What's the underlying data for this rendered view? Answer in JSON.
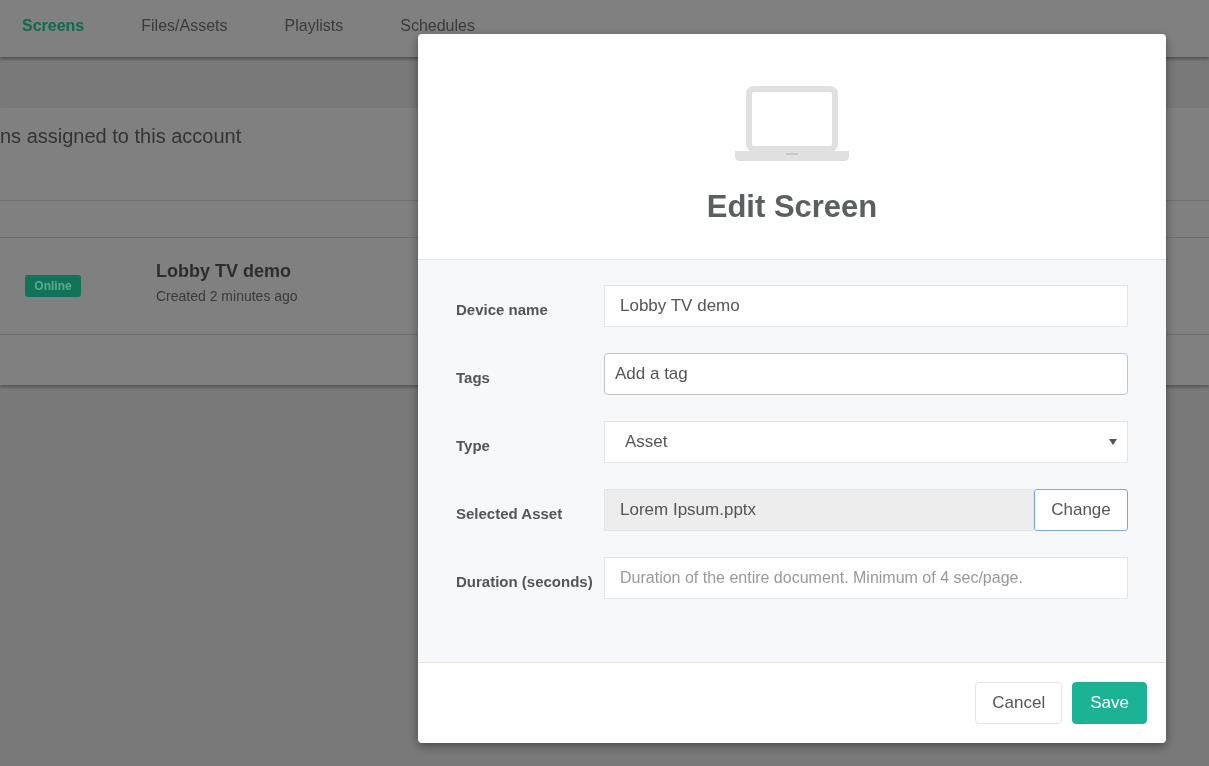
{
  "nav": {
    "tabs": [
      {
        "label": "Screens",
        "selected": true
      },
      {
        "label": "Files/Assets",
        "selected": false
      },
      {
        "label": "Playlists",
        "selected": false
      },
      {
        "label": "Schedules",
        "selected": false
      }
    ]
  },
  "page": {
    "heading": "ns assigned to this account",
    "screens": [
      {
        "status": "Online",
        "name": "Lobby TV demo",
        "created": "Created 2 minutes ago"
      }
    ]
  },
  "modal": {
    "title": "Edit Screen",
    "fields": [
      {
        "kind": "text",
        "label": "Device name",
        "value": "Lobby TV demo"
      },
      {
        "kind": "tags",
        "label": "Tags",
        "placeholder": "Add a tag"
      },
      {
        "kind": "select",
        "label": "Type",
        "value": "Asset"
      },
      {
        "kind": "asset",
        "label": "Selected Asset",
        "value": "Lorem Ipsum.pptx",
        "button": "Change"
      },
      {
        "kind": "number",
        "label": "Duration (seconds)",
        "placeholder": "Duration of the entire document. Minimum of 4 sec/page."
      }
    ],
    "buttons": [
      {
        "label": "Cancel",
        "kind": "secondary"
      },
      {
        "label": "Save",
        "kind": "primary"
      }
    ]
  }
}
